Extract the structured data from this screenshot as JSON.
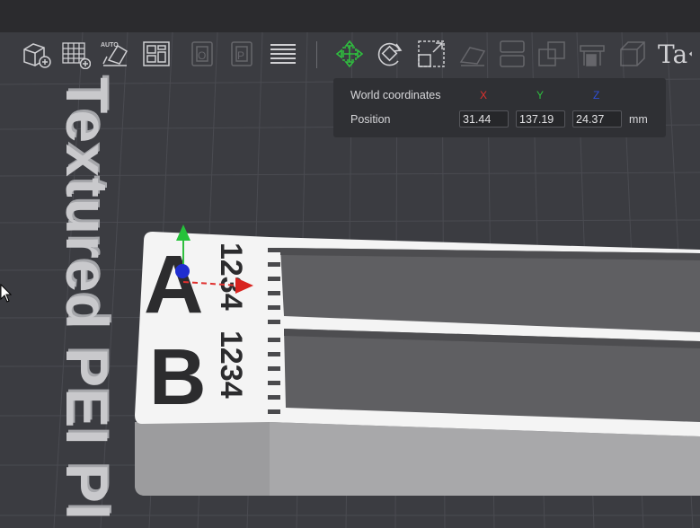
{
  "toolbar": {
    "tools": [
      {
        "name": "add-object-icon",
        "enabled": true
      },
      {
        "name": "add-plate-icon",
        "enabled": true
      },
      {
        "name": "auto-orient-icon",
        "enabled": true,
        "label": "AUTO"
      },
      {
        "name": "arrange-icon",
        "enabled": true
      },
      {
        "name": "split-objects-icon",
        "enabled": false
      },
      {
        "name": "split-parts-icon",
        "enabled": false
      },
      {
        "name": "layers-icon",
        "enabled": true
      },
      {
        "name": "move-icon",
        "enabled": true
      },
      {
        "name": "rotate-icon",
        "enabled": true
      },
      {
        "name": "scale-icon",
        "enabled": true
      },
      {
        "name": "lay-on-face-icon",
        "enabled": false
      },
      {
        "name": "cut-icon",
        "enabled": false
      },
      {
        "name": "mesh-boolean-icon",
        "enabled": false
      },
      {
        "name": "support-paint-icon",
        "enabled": false
      },
      {
        "name": "seam-paint-icon",
        "enabled": false
      },
      {
        "name": "text-tool-icon",
        "enabled": true
      },
      {
        "name": "measure-icon",
        "enabled": true
      }
    ],
    "auto_label": "AUTO",
    "text_tool_label": "Ta"
  },
  "coordinates": {
    "title": "World coordinates",
    "axes": {
      "x": "X",
      "y": "Y",
      "z": "Z"
    },
    "axis_colors": {
      "x": "#e0302e",
      "y": "#2fbf3f",
      "z": "#2f4fd8"
    },
    "row_label": "Position",
    "x": "31.44",
    "y": "137.19",
    "z": "24.37",
    "unit": "mm"
  },
  "plate": {
    "label": "Textured PEI Pl"
  },
  "model": {
    "letter_a": "A",
    "letter_b": "B",
    "numbers_top": "1234",
    "numbers_bottom": "1234"
  }
}
